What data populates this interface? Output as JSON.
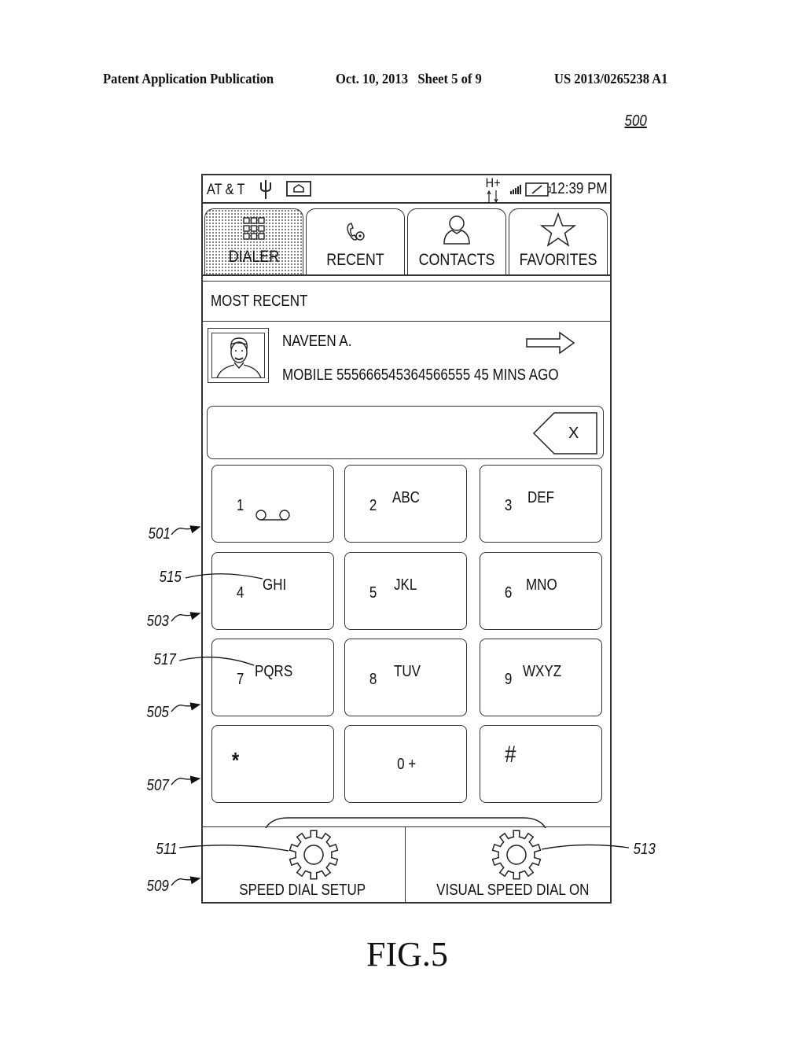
{
  "header": {
    "publication": "Patent Application Publication",
    "date_sheet": "Oct. 10, 2013   Sheet 5 of 9",
    "number": "US 2013/0265238 A1"
  },
  "figure_ref": "500",
  "figure_caption": "FIG.5",
  "status_bar": {
    "carrier": "AT & T",
    "network": "H+",
    "time": "12:39 PM",
    "icons": [
      "usb-icon",
      "notification-icon",
      "network-arrows-icon",
      "signal-icon",
      "battery-icon"
    ]
  },
  "tabs": [
    {
      "label": "DIALER",
      "icon": "keypad-icon",
      "active": true
    },
    {
      "label": "RECENT",
      "icon": "phone-clock-icon",
      "active": false
    },
    {
      "label": "CONTACTS",
      "icon": "person-icon",
      "active": false
    },
    {
      "label": "FAVORITES",
      "icon": "star-icon",
      "active": false
    }
  ],
  "most_recent": {
    "heading": "MOST RECENT",
    "name": "NAVEEN A.",
    "detail": "MOBILE 555666545364566555 45 MINS AGO"
  },
  "entry": {
    "value": "",
    "backspace_label": "X"
  },
  "keys": [
    {
      "digit": "1",
      "letters": ""
    },
    {
      "digit": "2",
      "letters": "ABC"
    },
    {
      "digit": "3",
      "letters": "DEF"
    },
    {
      "digit": "4",
      "letters": "GHI"
    },
    {
      "digit": "5",
      "letters": "JKL"
    },
    {
      "digit": "6",
      "letters": "MNO"
    },
    {
      "digit": "7",
      "letters": "PQRS"
    },
    {
      "digit": "8",
      "letters": "TUV"
    },
    {
      "digit": "9",
      "letters": "WXYZ"
    },
    {
      "digit": "*",
      "letters": ""
    },
    {
      "digit": "0 +",
      "letters": ""
    },
    {
      "digit": "#",
      "letters": ""
    }
  ],
  "bottom_buttons": {
    "speed_dial_setup": "SPEED DIAL SETUP",
    "visual_speed_dial": "VISUAL SPEED DIAL ON"
  },
  "reference_numerals": {
    "r501": "501",
    "r503": "503",
    "r505": "505",
    "r507": "507",
    "r509": "509",
    "r511": "511",
    "r513": "513",
    "r515": "515",
    "r517": "517"
  }
}
